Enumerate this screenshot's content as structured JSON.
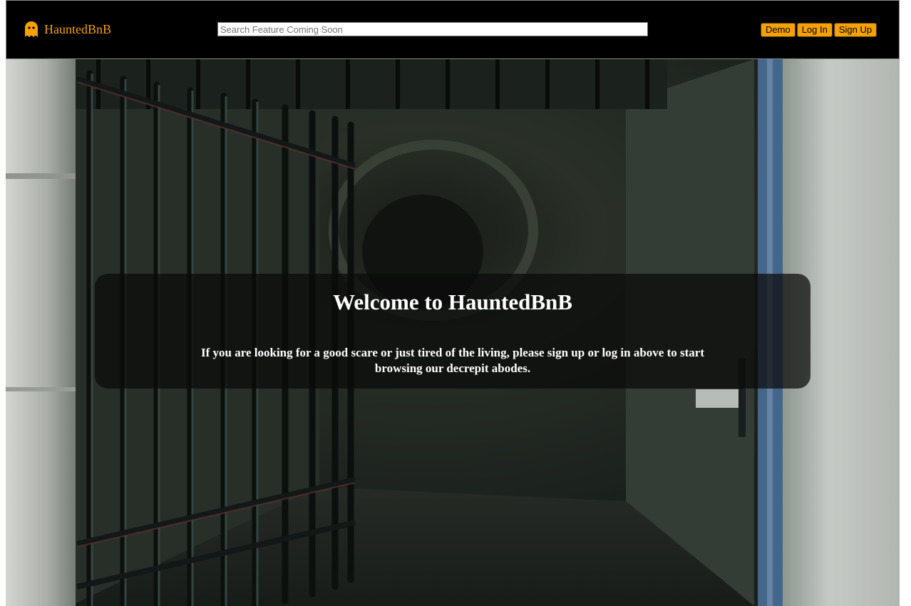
{
  "header": {
    "brand_name": "HauntedBnB",
    "brand_icon": "ghost-icon",
    "search": {
      "placeholder": "Search Feature Coming Soon",
      "value": ""
    },
    "buttons": {
      "demo": "Demo",
      "login": "Log In",
      "signup": "Sign Up"
    }
  },
  "hero": {
    "background_image": "dark dungeon corridor with open iron gate",
    "title": "Welcome to HauntedBnB",
    "message": "If you are looking for a good scare or just tired of the living, please sign up or log in above to start browsing our decrepit abodes."
  },
  "colors": {
    "accent": "#f5a100",
    "navbar_bg": "#000000",
    "overlay_bg": "rgba(10,10,10,0.72)",
    "text_light": "#ffffff"
  }
}
